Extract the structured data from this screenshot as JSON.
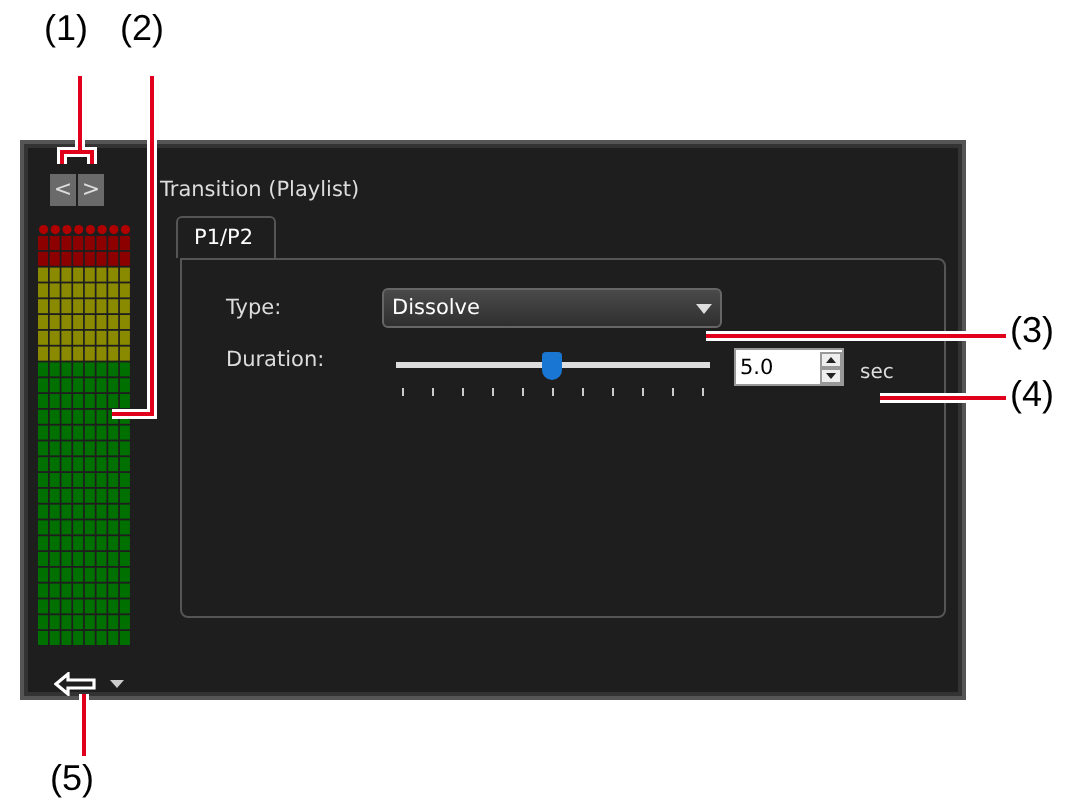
{
  "window": {
    "title": "Transition (Playlist)",
    "nav_buttons": [
      "<",
      ">"
    ]
  },
  "tabs": [
    {
      "label": "P1/P2",
      "selected": true
    }
  ],
  "form": {
    "type_label": "Type:",
    "type_value": "Dissolve",
    "duration_label": "Duration:",
    "duration": {
      "level": 0.5
    },
    "duration_value": "5.0",
    "unit": "sec"
  },
  "callouts": [
    {
      "label": "(1)"
    },
    {
      "label": "(2)"
    },
    {
      "label": "(3)"
    },
    {
      "label": "(4)"
    },
    {
      "label": "(5)"
    }
  ]
}
